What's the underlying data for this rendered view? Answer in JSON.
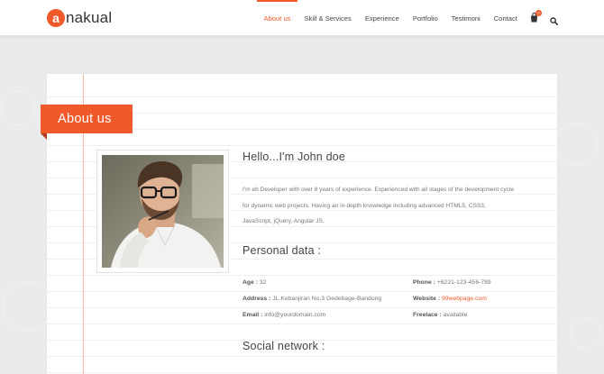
{
  "brand": {
    "mark": "a",
    "text": "nakual",
    "accent": "#f05a2b"
  },
  "nav": {
    "items": [
      {
        "label": "About us",
        "active": true
      },
      {
        "label": "Skill & Services"
      },
      {
        "label": "Experience"
      },
      {
        "label": "Portfolio"
      },
      {
        "label": "Testimoni"
      },
      {
        "label": "Contact"
      }
    ],
    "cart_icon": "shopping-bag-icon",
    "cart_count": "0",
    "search_icon": "search-icon"
  },
  "section": {
    "ribbon": "About us"
  },
  "profile": {
    "greeting": "Hello...I'm John doe",
    "bio_lines": [
      "I'm eb Developer with over 8 years of experience. Experienced with all stages of the development cycle",
      "for dynamic web projects. Having an in-depth knowledge including advanced HTML5, CSS3,",
      "JavaScript, jQuery, Angular JS."
    ]
  },
  "personal": {
    "title": "Personal data :",
    "age_label": "Age :",
    "age": "32",
    "address_label": "Address :",
    "address": "JL.Kebanjiran No.3 Gedebage-Bandung",
    "email_label": "Email :",
    "email": "info@yourdomain.com",
    "phone_label": "Phone :",
    "phone": "+6221-123-456-789",
    "website_label": "Website :",
    "website": "99webpage.com",
    "freelance_label": "Freelace :",
    "freelance": "available"
  },
  "social": {
    "title": "Social network :"
  }
}
